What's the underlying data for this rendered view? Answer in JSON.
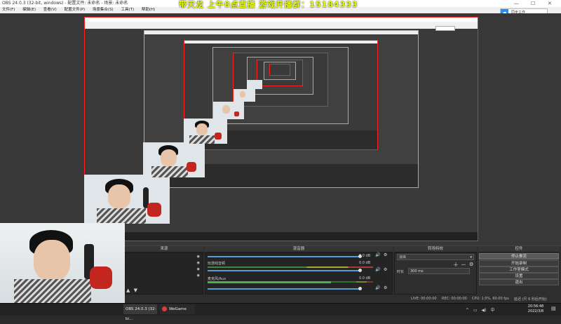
{
  "window": {
    "title": "OBS 24.0.3 (32-bit, windows) - 配置文件: 未命名 - 场景: 未命名",
    "minimize_glyph": "—",
    "maximize_glyph": "☐",
    "close_glyph": "✕"
  },
  "menu": [
    "文件(F)",
    "编辑(E)",
    "查看(V)",
    "配置文件(P)",
    "场景集合(S)",
    "工具(T)",
    "帮助(H)"
  ],
  "overlay_title": "带天龙 上午8点直播   游戏开播群：15184333",
  "sync_button": {
    "label": "同步工作"
  },
  "dock_headers": {
    "sources": "来源",
    "mixer": "混音器",
    "transitions": "转场特效",
    "controls": "控件"
  },
  "sources": [
    {
      "name": "",
      "visible": true
    },
    {
      "name": "",
      "visible": true
    },
    {
      "name": "",
      "visible": true
    },
    {
      "name": "",
      "visible": true
    }
  ],
  "mixer": [
    {
      "name": "",
      "db": "0.0 dB",
      "volume": 0.92
    },
    {
      "name": "玩游戏音频",
      "db": "0.0 dB",
      "volume": 0.92
    },
    {
      "name": "麦克风/Aux",
      "db": "0.0 dB",
      "volume": 0.92
    }
  ],
  "transitions": {
    "type": "淡出",
    "duration_label": "时长",
    "duration_value": "300 ms"
  },
  "controls": [
    "停止推流",
    "开始录制",
    "工作室模式",
    "设置",
    "退出"
  ],
  "status": {
    "live": "LIVE: 00:00:00",
    "rec": "REC: 00:00:00",
    "cpu": "CPU: 1.0%, 60.00 fps",
    "extra": "延迟 (尺 6 秒后开始)"
  },
  "taskbar": {
    "obs_item": "OBS 24.0.3 (32-bi...",
    "wegame_item": "WeGame",
    "time": "20:56:48",
    "date": "2022/3/8"
  },
  "icons": {
    "eye": "eye-icon",
    "lock": "lock-icon",
    "gear": "gear-icon",
    "speaker": "speaker-icon",
    "plus": "plus-icon",
    "minus": "minus-icon"
  },
  "colors": {
    "overlay_text": "#e6ff00",
    "preview_border": "#ff2020",
    "sync_icon": "#2d8cf0"
  }
}
